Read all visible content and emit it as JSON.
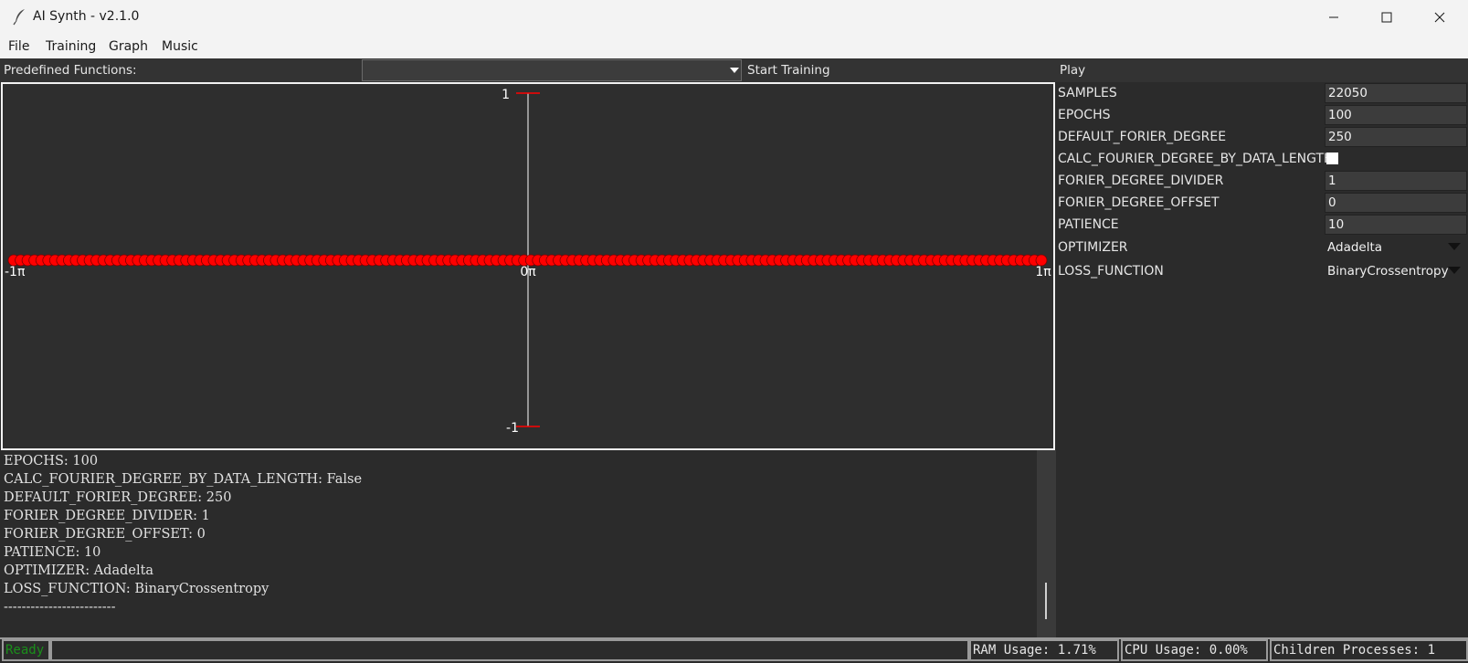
{
  "window": {
    "title": "AI Synth - v2.1.0",
    "icon": "feather-icon",
    "controls": [
      "minimize-icon",
      "maximize-icon",
      "close-icon"
    ]
  },
  "menu": {
    "items": [
      "File",
      "Training",
      "Graph",
      "Music"
    ]
  },
  "toolbar": {
    "predefined_label": "Predefined Functions:",
    "predefined_value": "",
    "start_training": "Start Training",
    "play": "Play"
  },
  "graph": {
    "y_max_label": "1",
    "y_min_label": "-1",
    "x_labels": [
      "-1π",
      "0π",
      "1π"
    ],
    "point_color": "#ff0000",
    "axis_color": "#ffffff",
    "tick_color": "#ff0000",
    "point_count": 150,
    "y_value": 0
  },
  "params": {
    "samples": {
      "label": "SAMPLES",
      "value": "22050"
    },
    "epochs": {
      "label": "EPOCHS",
      "value": "100"
    },
    "default_degree": {
      "label": "DEFAULT_FORIER_DEGREE",
      "value": "250"
    },
    "calc_by_length": {
      "label": "CALC_FOURIER_DEGREE_BY_DATA_LENGTH",
      "checked": false
    },
    "degree_divider": {
      "label": "FORIER_DEGREE_DIVIDER",
      "value": "1"
    },
    "degree_offset": {
      "label": "FORIER_DEGREE_OFFSET",
      "value": "0"
    },
    "patience": {
      "label": "PATIENCE",
      "value": "10"
    },
    "optimizer": {
      "label": "OPTIMIZER",
      "value": "Adadelta"
    },
    "loss": {
      "label": "LOSS_FUNCTION",
      "value": "BinaryCrossentropy"
    }
  },
  "console": {
    "lines": [
      "EPOCHS: 100",
      "CALC_FOURIER_DEGREE_BY_DATA_LENGTH: False",
      "DEFAULT_FORIER_DEGREE: 250",
      "FORIER_DEGREE_DIVIDER: 1",
      "FORIER_DEGREE_OFFSET: 0",
      "PATIENCE: 10",
      "OPTIMIZER: Adadelta",
      "LOSS_FUNCTION: BinaryCrossentropy",
      "-------------------------"
    ]
  },
  "status": {
    "ready": "Ready",
    "ready_color": "#1a8f1a",
    "ram": "RAM Usage: 1.71%",
    "cpu": "CPU Usage: 0.00%",
    "children": "Children Processes: 1"
  }
}
